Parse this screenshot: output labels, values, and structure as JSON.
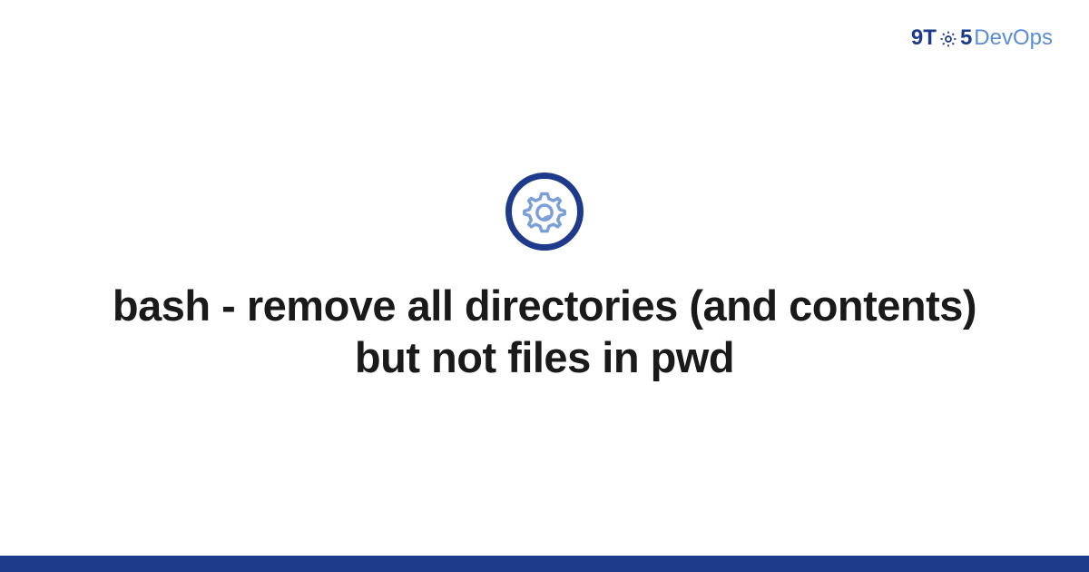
{
  "logo": {
    "part1": "9T",
    "part2": "5",
    "part3": "DevOps",
    "gear_icon": "gear-icon"
  },
  "center": {
    "icon_name": "gear-icon",
    "headline": "bash - remove all directories (and contents) but not files in pwd"
  },
  "colors": {
    "primary_dark": "#1e3a8a",
    "accent_light": "#5b8dd6",
    "gear_fill": "#7b9fd8",
    "text": "#1a1a1a",
    "background": "#ffffff"
  }
}
